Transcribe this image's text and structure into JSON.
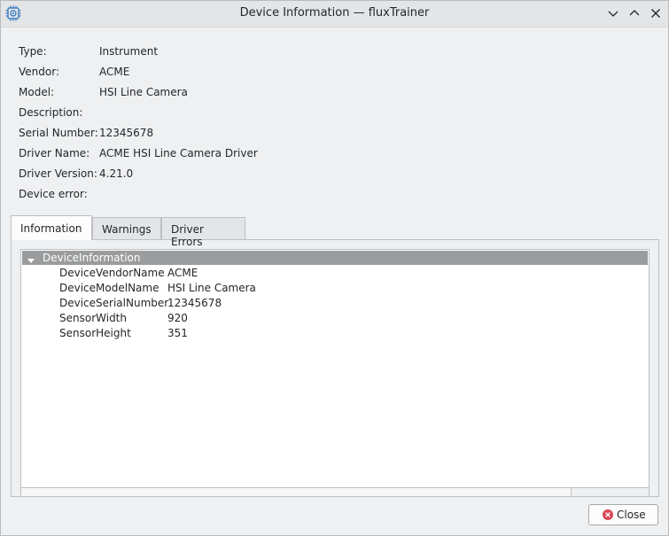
{
  "window": {
    "title": "Device Information — fluxTrainer",
    "app_icon": "gear-chip-icon"
  },
  "fields": [
    {
      "label": "Type:",
      "value": "Instrument"
    },
    {
      "label": "Vendor:",
      "value": "ACME"
    },
    {
      "label": "Model:",
      "value": "HSI Line Camera"
    },
    {
      "label": "Description:",
      "value": ""
    },
    {
      "label": "Serial Number:",
      "value": "12345678"
    },
    {
      "label": "Driver Name:",
      "value": "ACME HSI Line Camera Driver"
    },
    {
      "label": "Driver Version:",
      "value": "4.21.0"
    },
    {
      "label": "Device error:",
      "value": ""
    }
  ],
  "tabs": [
    {
      "label": "Information",
      "active": true
    },
    {
      "label": "Warnings",
      "active": false
    },
    {
      "label": "Driver Errors",
      "active": false
    }
  ],
  "tree": {
    "root": "DeviceInformation",
    "rows": [
      {
        "key": "DeviceVendorName",
        "value": "ACME"
      },
      {
        "key": "DeviceModelName",
        "value": "HSI Line Camera"
      },
      {
        "key": "DeviceSerialNumber",
        "value": "12345678"
      },
      {
        "key": "SensorWidth",
        "value": "920"
      },
      {
        "key": "SensorHeight",
        "value": "351"
      }
    ]
  },
  "buttons": {
    "close_label": "Close"
  },
  "colors": {
    "tree_root_bg": "#9a9c9e",
    "close_icon": "#da4453"
  }
}
